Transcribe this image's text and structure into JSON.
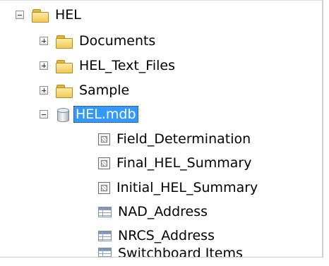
{
  "tree": {
    "root": {
      "label": "HEL",
      "expanded": true
    },
    "folders": [
      {
        "label": "Documents",
        "expanded": false
      },
      {
        "label": "HEL_Text_Files",
        "expanded": false
      },
      {
        "label": "Sample",
        "expanded": false
      }
    ],
    "database": {
      "label": "HEL.mdb",
      "expanded": true,
      "selected": true
    },
    "items": [
      {
        "label": "Field_Determination",
        "type": "feature-class"
      },
      {
        "label": "Final_HEL_Summary",
        "type": "feature-class"
      },
      {
        "label": "Initial_HEL_Summary",
        "type": "feature-class"
      },
      {
        "label": "NAD_Address",
        "type": "table"
      },
      {
        "label": "NRCS_Address",
        "type": "table"
      },
      {
        "label": "Switchboard Items",
        "type": "table"
      }
    ]
  },
  "colors": {
    "selection": "#3399ff",
    "folder": "#f2c85a"
  }
}
